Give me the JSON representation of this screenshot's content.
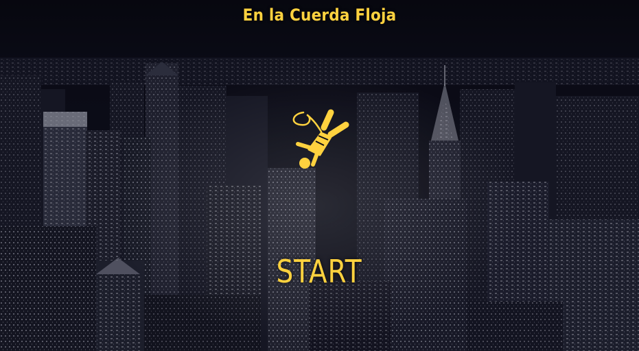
{
  "game": {
    "title": "En la Cuerda Floja",
    "start_label": "START",
    "logo_icon": "tightrope-walker-icon"
  },
  "colors": {
    "accent": "#ffd23f",
    "sky": "#0a0b14"
  }
}
